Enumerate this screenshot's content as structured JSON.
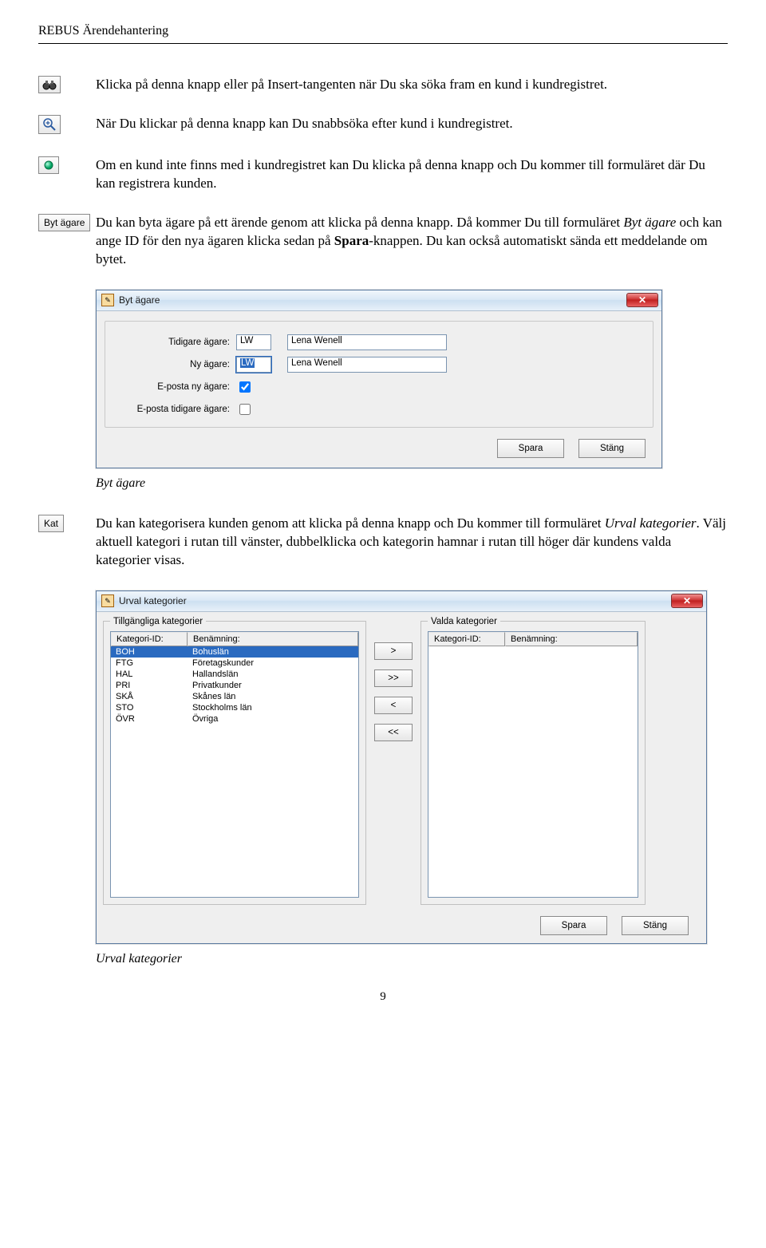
{
  "header": {
    "title": "REBUS Ärendehantering"
  },
  "para": {
    "p1": "Klicka på denna knapp eller på Insert-tangenten när Du ska söka fram en kund i kundregistret.",
    "p2": "När Du klickar på denna knapp kan Du snabbsöka efter kund i kundregistret.",
    "p3": "Om en kund inte finns med i kundregistret kan Du klicka på denna knapp och Du kommer till formuläret där Du kan registrera kunden.",
    "p4a": "Du kan byta ägare på ett ärende genom att klicka på denna knapp. Då kommer Du till formuläret ",
    "p4b": "Byt ägare",
    "p4c": " och kan ange ID för den nya ägaren klicka sedan på ",
    "p4d": "Spara",
    "p4e": "-knappen. Du kan också automatiskt sända ett meddelande om bytet.",
    "p5a": "Du kan kategorisera kunden genom att klicka på denna knapp och Du kommer till formuläret ",
    "p5b": "Urval kategorier",
    "p5c": ". Välj aktuell kategori i rutan till vänster, dubbelklicka och kategorin hamnar i rutan till höger där kundens valda kategorier visas."
  },
  "buttons": {
    "bytAga": "Byt ägare",
    "kat": "Kat"
  },
  "bytAgare": {
    "title": "Byt ägare",
    "tidigareLabel": "Tidigare ägare:",
    "nyLabel": "Ny ägare:",
    "epostNyLabel": "E-posta ny ägare:",
    "epostTidigareLabel": "E-posta tidigare ägare:",
    "tidigareId": "LW",
    "tidigareNamn": "Lena Wenell",
    "nyId": "LW",
    "nyNamn": "Lena Wenell",
    "spara": "Spara",
    "stang": "Stäng",
    "caption": "Byt ägare"
  },
  "urval": {
    "title": "Urval kategorier",
    "leftLegend": "Tillgängliga kategorier",
    "rightLegend": "Valda kategorier",
    "colId": "Kategori-ID:",
    "colName": "Benämning:",
    "rows": [
      {
        "id": "BOH",
        "name": "Bohuslän"
      },
      {
        "id": "FTG",
        "name": "Företagskunder"
      },
      {
        "id": "HAL",
        "name": "Hallandslän"
      },
      {
        "id": "PRI",
        "name": "Privatkunder"
      },
      {
        "id": "SKÅ",
        "name": "Skånes län"
      },
      {
        "id": "STO",
        "name": "Stockholms län"
      },
      {
        "id": "ÖVR",
        "name": "Övriga"
      }
    ],
    "btnR": ">",
    "btnRR": ">>",
    "btnL": "<",
    "btnLL": "<<",
    "spara": "Spara",
    "stang": "Stäng",
    "caption": "Urval kategorier"
  },
  "pageNumber": "9"
}
